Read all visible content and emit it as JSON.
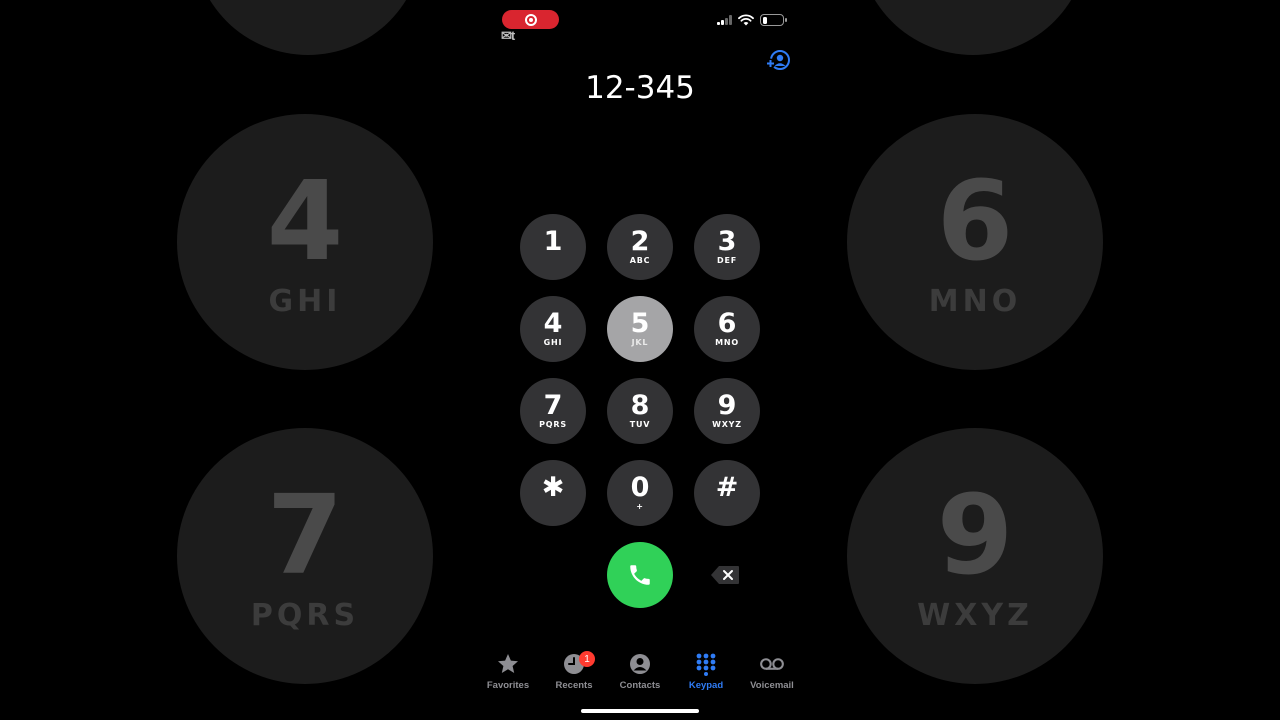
{
  "status_bar": {
    "recording_indicator": "record-icon",
    "app_mark": "✉t",
    "battery_level": 0.25
  },
  "dialer": {
    "number": "12-345",
    "keys": [
      {
        "digit": "1",
        "letters": ""
      },
      {
        "digit": "2",
        "letters": "ABC"
      },
      {
        "digit": "3",
        "letters": "DEF"
      },
      {
        "digit": "4",
        "letters": "GHI"
      },
      {
        "digit": "5",
        "letters": "JKL"
      },
      {
        "digit": "6",
        "letters": "MNO"
      },
      {
        "digit": "7",
        "letters": "PQRS"
      },
      {
        "digit": "8",
        "letters": "TUV"
      },
      {
        "digit": "9",
        "letters": "WXYZ"
      },
      {
        "digit": "✱",
        "letters": ""
      },
      {
        "digit": "0",
        "letters": "+"
      },
      {
        "digit": "#",
        "letters": ""
      }
    ],
    "pressed_key": "5"
  },
  "background_keys": [
    {
      "digit": "4",
      "letters": "GHI"
    },
    {
      "digit": "6",
      "letters": "MNO"
    },
    {
      "digit": "7",
      "letters": "PQRS"
    },
    {
      "digit": "9",
      "letters": "WXYZ"
    }
  ],
  "tabs": [
    {
      "label": "Favorites",
      "icon": "star-icon"
    },
    {
      "label": "Recents",
      "icon": "clock-icon",
      "badge": "1"
    },
    {
      "label": "Contacts",
      "icon": "person-circle-icon"
    },
    {
      "label": "Keypad",
      "icon": "keypad-icon",
      "active": true
    },
    {
      "label": "Voicemail",
      "icon": "voicemail-icon"
    }
  ],
  "colors": {
    "accent": "#2f7cf6",
    "call": "#30d158",
    "badge": "#ff3b30",
    "record": "#d9252f"
  }
}
